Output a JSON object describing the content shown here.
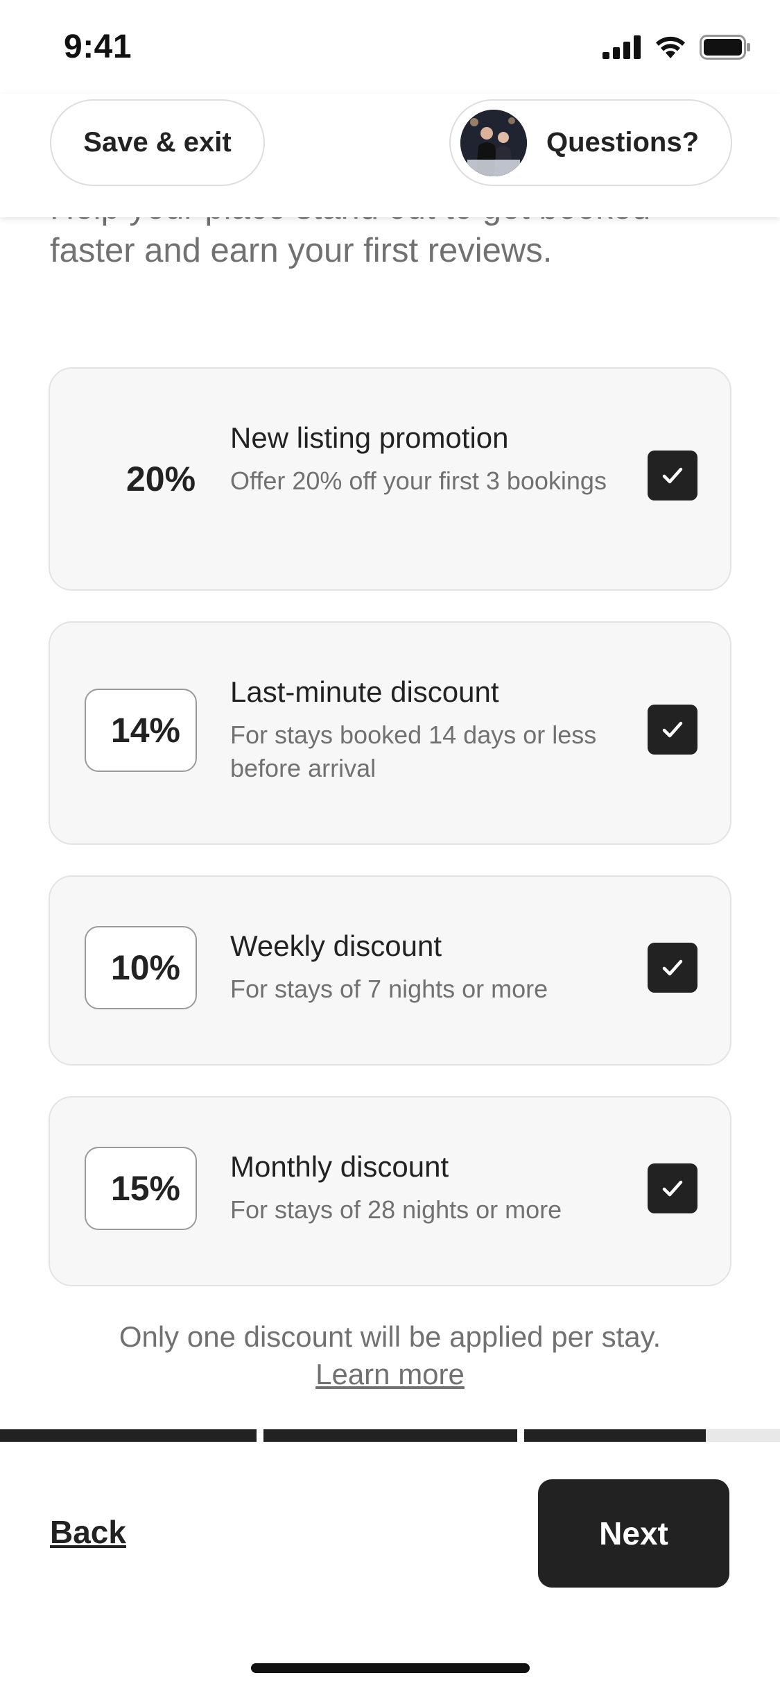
{
  "status_bar": {
    "time": "9:41"
  },
  "header": {
    "save_exit_label": "Save & exit",
    "questions_label": "Questions?"
  },
  "intro": {
    "line_partial": "Help your place stand out to get booked",
    "line2": "faster and earn your first reviews."
  },
  "discounts": [
    {
      "percent": "20%",
      "title": "New listing promotion",
      "description": "Offer 20% off your first 3 bookings",
      "checked": true
    },
    {
      "percent": "14%",
      "title": "Last-minute discount",
      "description": "For stays booked 14 days or less before arrival",
      "checked": true
    },
    {
      "percent": "10%",
      "title": "Weekly discount",
      "description": "For stays of 7 nights or more",
      "checked": true
    },
    {
      "percent": "15%",
      "title": "Monthly discount",
      "description": "For stays of 28 nights or more",
      "checked": true
    }
  ],
  "note": "Only one discount will be applied per stay.",
  "learn_more": "Learn more",
  "progress": {
    "steps_completed": 2,
    "current_step_fraction": 0.71,
    "total_steps": 3
  },
  "footer": {
    "back_label": "Back",
    "next_label": "Next"
  },
  "colors": {
    "primary": "#222222",
    "muted_text": "#717171",
    "card_bg": "#f7f7f7"
  }
}
